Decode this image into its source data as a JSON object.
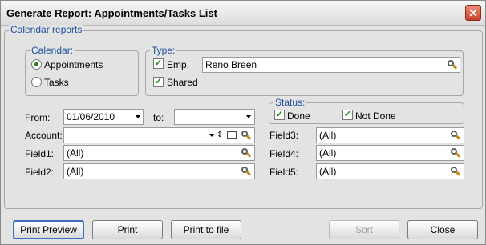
{
  "window": {
    "title": "Generate Report:  Appointments/Tasks List",
    "close_glyph": "✕"
  },
  "main_group": {
    "legend": "Calendar reports"
  },
  "calendar": {
    "legend": "Calendar:",
    "options": [
      {
        "label": "Appointments",
        "selected": true
      },
      {
        "label": "Tasks",
        "selected": false
      }
    ]
  },
  "type": {
    "legend": "Type:",
    "emp_label": "Emp.",
    "emp_checked": true,
    "emp_value": "Reno Breen",
    "shared_label": "Shared",
    "shared_checked": true
  },
  "dates": {
    "from_label": "From:",
    "from_value": "01/06/2010",
    "to_label": "to:",
    "to_value": ""
  },
  "status": {
    "legend": "Status:",
    "done_label": "Done",
    "done_checked": true,
    "notdone_label": "Not Done",
    "notdone_checked": true
  },
  "fields": {
    "account_label": "Account:",
    "account_value": "",
    "field1_label": "Field1:",
    "field1_value": "(All)",
    "field2_label": "Field2:",
    "field2_value": "(All)",
    "field3_label": "Field3:",
    "field3_value": "(All)",
    "field4_label": "Field4:",
    "field4_value": "(All)",
    "field5_label": "Field5:",
    "field5_value": "(All)"
  },
  "buttons": {
    "print_preview": "Print Preview",
    "print": "Print",
    "print_to_file": "Print to file",
    "sort": "Sort",
    "close": "Close"
  },
  "icons": {
    "search": "search-icon",
    "dropdown": "chevron-down-icon",
    "check": "checkmark-icon",
    "envelope": "envelope-icon",
    "sort_toggle": "sort-arrows-icon"
  },
  "colors": {
    "legend_text": "#1d4f9e",
    "default_button_border": "#3b6fbf",
    "checkmark": "#1d7d1d"
  }
}
